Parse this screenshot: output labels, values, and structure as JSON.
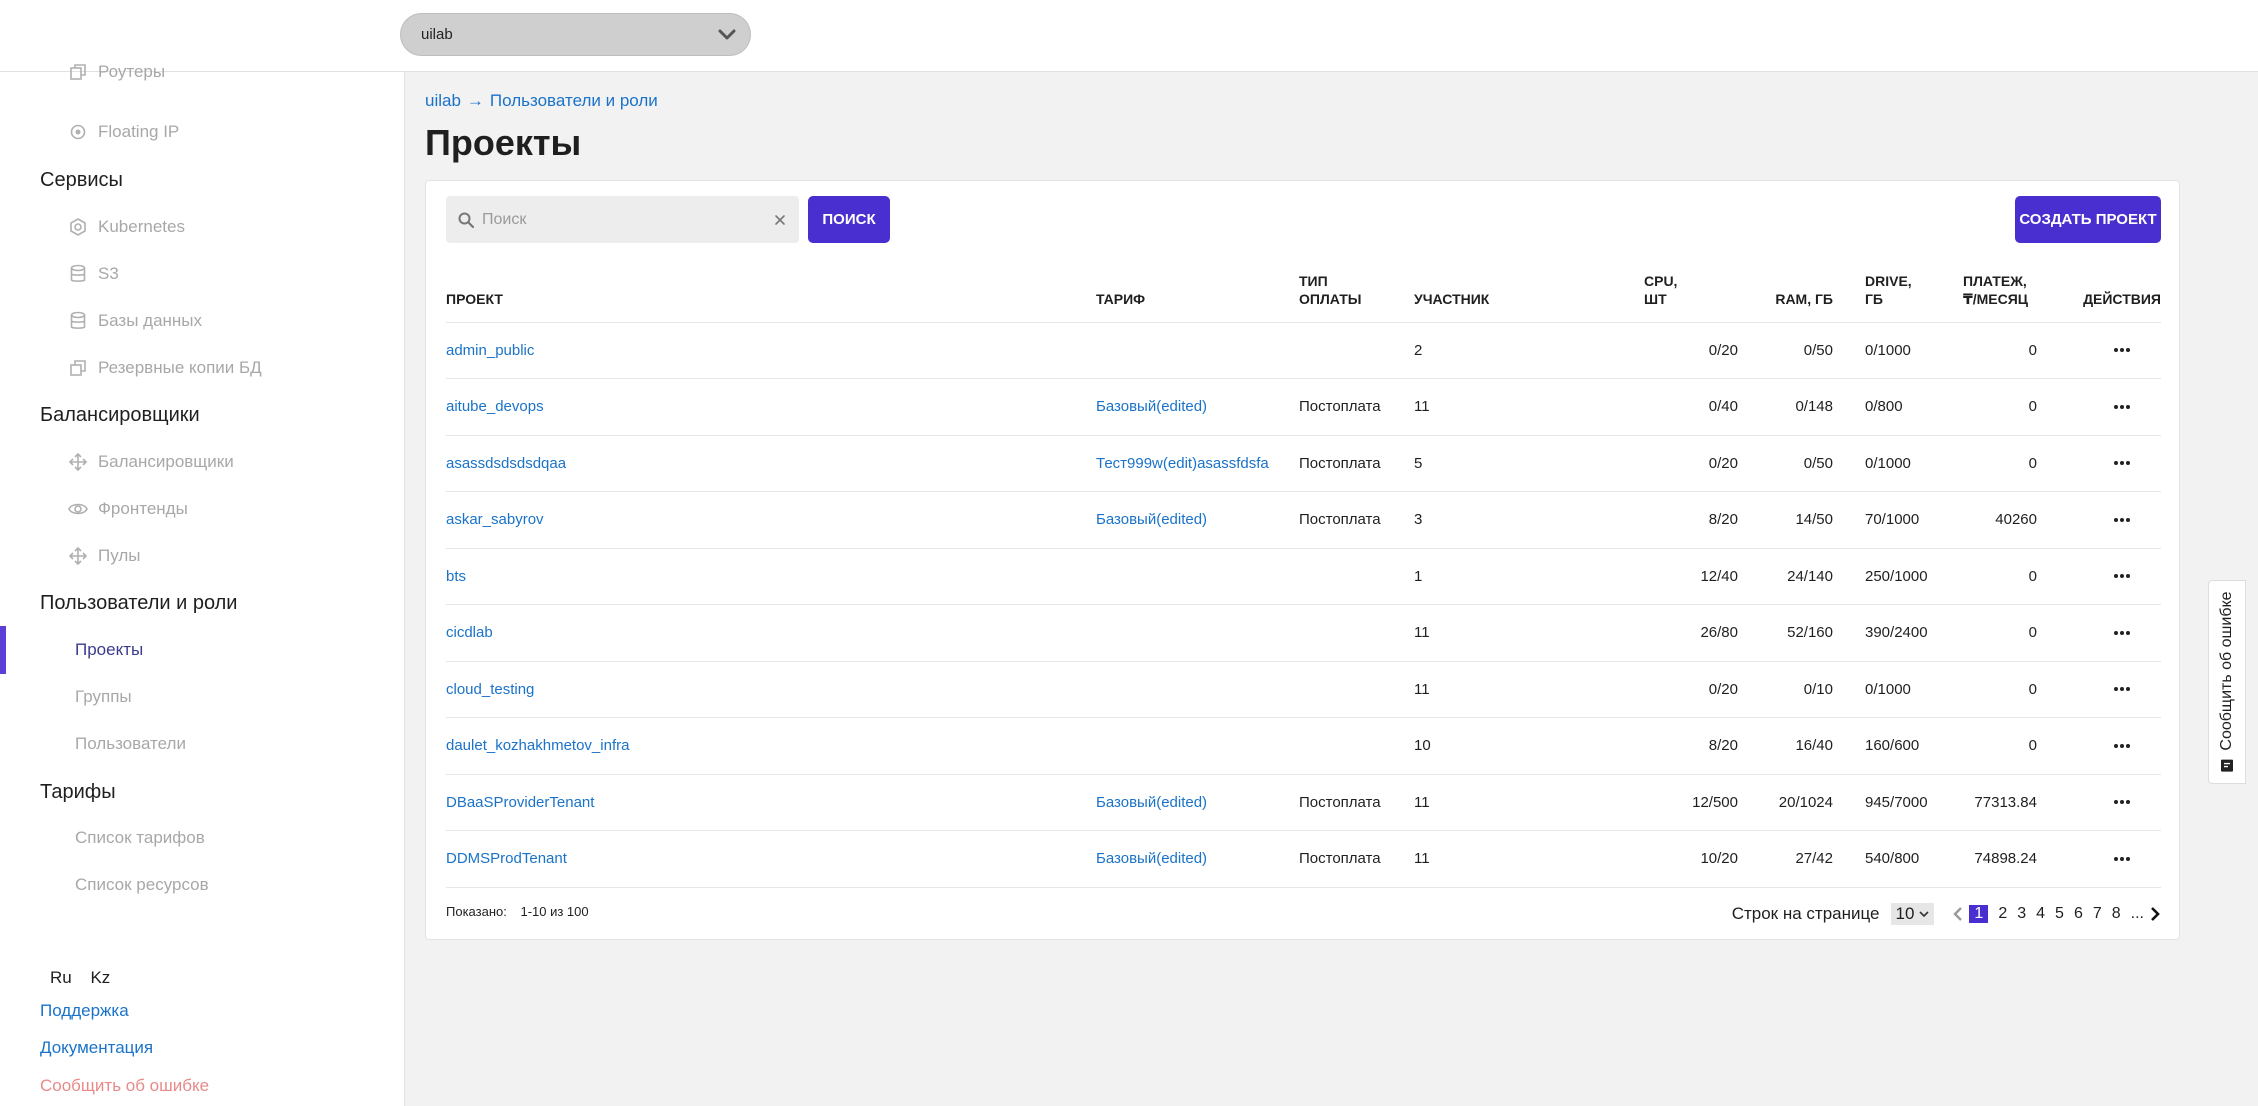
{
  "topbar": {
    "project_selector": "uilab"
  },
  "sidebar": {
    "network_items": [
      {
        "label": "Роутеры",
        "icon": "router-icon"
      },
      {
        "label": "Floating IP",
        "icon": "floating-ip-icon"
      }
    ],
    "services": {
      "title": "Сервисы",
      "items": [
        {
          "label": "Kubernetes",
          "icon": "kubernetes-icon"
        },
        {
          "label": "S3",
          "icon": "storage-icon"
        },
        {
          "label": "Базы данных",
          "icon": "database-icon"
        },
        {
          "label": "Резервные копии БД",
          "icon": "backup-icon"
        }
      ]
    },
    "balancers": {
      "title": "Балансировщики",
      "items": [
        {
          "label": "Балансировщики",
          "icon": "balancer-icon"
        },
        {
          "label": "Фронтенды",
          "icon": "eye-icon"
        },
        {
          "label": "Пулы",
          "icon": "pool-icon"
        }
      ]
    },
    "users_roles": {
      "title": "Пользователи и роли",
      "items": [
        {
          "label": "Проекты",
          "active": true
        },
        {
          "label": "Группы"
        },
        {
          "label": "Пользователи"
        }
      ]
    },
    "tariffs": {
      "title": "Тарифы",
      "items": [
        {
          "label": "Список тарифов"
        },
        {
          "label": "Список ресурсов"
        }
      ]
    },
    "languages": [
      "Ru",
      "Kz"
    ],
    "support": "Поддержка",
    "docs": "Документация",
    "report_error": "Сообщить об ошибке"
  },
  "breadcrumb": {
    "root": "uilab",
    "arrow": "→",
    "current": "Пользователи и роли"
  },
  "page_title": "Проекты",
  "search": {
    "placeholder": "Поиск",
    "button": "Поиск"
  },
  "create_button": "Создать проект",
  "table": {
    "headers": {
      "project": "Проект",
      "tariff": "Тариф",
      "payment_type_1": "Тип",
      "payment_type_2": "оплаты",
      "participant": "Участник",
      "cpu_1": "CPU,",
      "cpu_2": "шт",
      "ram": "RAM, ГБ",
      "drive_1": "DRIVE,",
      "drive_2": "ГБ",
      "payment_1": "Платеж,",
      "payment_2": "₸/месяц",
      "actions": "Действия"
    },
    "rows": [
      {
        "project": "admin_public",
        "tariff": "",
        "payment_type": "",
        "participant": "2",
        "cpu": "0/20",
        "ram": "0/50",
        "drive": "0/1000",
        "payment": "0"
      },
      {
        "project": "aitube_devops",
        "tariff": "Базовый(edited)",
        "payment_type": "Постоплата",
        "participant": "11",
        "cpu": "0/40",
        "ram": "0/148",
        "drive": "0/800",
        "payment": "0"
      },
      {
        "project": "asassdsdsdsdqaa",
        "tariff": "Тест999w(edit)asassfdsfa",
        "payment_type": "Постоплата",
        "participant": "5",
        "cpu": "0/20",
        "ram": "0/50",
        "drive": "0/1000",
        "payment": "0"
      },
      {
        "project": "askar_sabyrov",
        "tariff": "Базовый(edited)",
        "payment_type": "Постоплата",
        "participant": "3",
        "cpu": "8/20",
        "ram": "14/50",
        "drive": "70/1000",
        "payment": "40260"
      },
      {
        "project": "bts",
        "tariff": "",
        "payment_type": "",
        "participant": "1",
        "cpu": "12/40",
        "ram": "24/140",
        "drive": "250/1000",
        "payment": "0"
      },
      {
        "project": "cicdlab",
        "tariff": "",
        "payment_type": "",
        "participant": "11",
        "cpu": "26/80",
        "ram": "52/160",
        "drive": "390/2400",
        "payment": "0"
      },
      {
        "project": "cloud_testing",
        "tariff": "",
        "payment_type": "",
        "participant": "11",
        "cpu": "0/20",
        "ram": "0/10",
        "drive": "0/1000",
        "payment": "0"
      },
      {
        "project": "daulet_kozhakhmetov_infra",
        "tariff": "",
        "payment_type": "",
        "participant": "10",
        "cpu": "8/20",
        "ram": "16/40",
        "drive": "160/600",
        "payment": "0"
      },
      {
        "project": "DBaaSProviderTenant",
        "tariff": "Базовый(edited)",
        "payment_type": "Постоплата",
        "participant": "11",
        "cpu": "12/500",
        "ram": "20/1024",
        "drive": "945/7000",
        "payment": "77313.84"
      },
      {
        "project": "DDMSProdTenant",
        "tariff": "Базовый(edited)",
        "payment_type": "Постоплата",
        "participant": "11",
        "cpu": "10/20",
        "ram": "27/42",
        "drive": "540/800",
        "payment": "74898.24"
      }
    ]
  },
  "footer": {
    "shown_label": "Показано:",
    "shown_range": "1-10 из 100",
    "rows_per_page_label": "Строк на странице",
    "rows_per_page": "10",
    "pages": [
      "1",
      "2",
      "3",
      "4",
      "5",
      "6",
      "7",
      "8"
    ],
    "current_page": "1",
    "ellipsis": "..."
  },
  "feedback_tab": "Сообщить об ошибке",
  "colors": {
    "accent": "#4a2fd0",
    "link": "#1a73c9",
    "error_link": "#e88a8a"
  }
}
